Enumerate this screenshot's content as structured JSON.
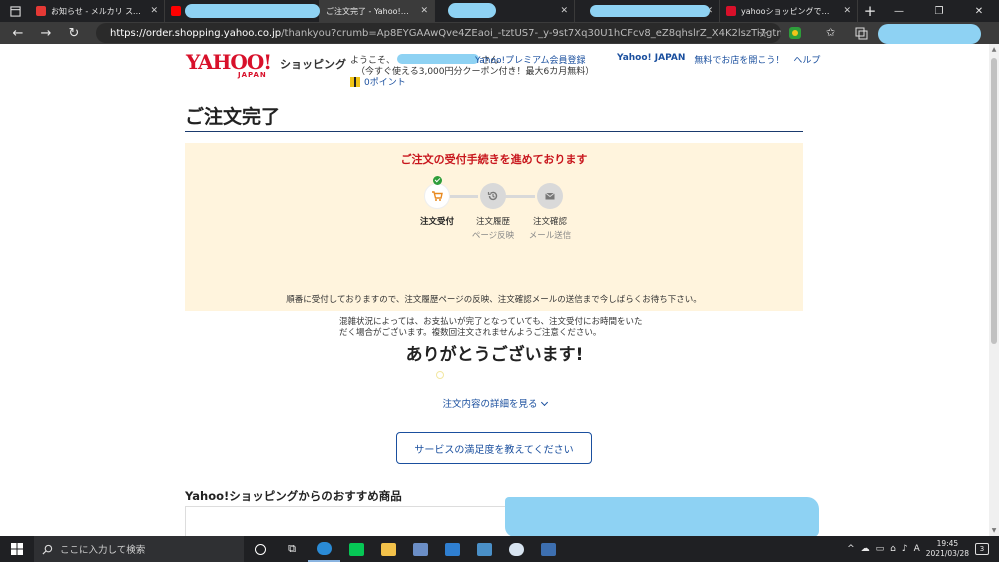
{
  "browser": {
    "tabs": [
      {
        "title": "お知らせ - メルカリ スマホでかんたん",
        "favicon_color": "#e53935",
        "active": false
      },
      {
        "title": "",
        "favicon_color": "#ff0000",
        "active": false
      },
      {
        "title": "ご注文完了 - Yahoo!ショッピング",
        "favicon_color": "#3b3b3b",
        "active": true
      },
      {
        "title": "",
        "favicon_color": "#8ed2f3",
        "active": false
      },
      {
        "title": "yahooショッピングで買い物をした",
        "favicon_color": "#d8102a",
        "active": false
      }
    ],
    "url_host": "https://order.shopping.yahoo.co.jp",
    "url_path": "/thankyou?crumb=Ap8EYGAAwQve4ZEaoi_-tztUS7-_y-9st7Xq30U1hCFcv8_eZ8qhslrZ_X4K2lszTi7gtm...",
    "window_controls": [
      "—",
      "❐",
      "✕"
    ]
  },
  "header": {
    "logo_text": "YAHOO!",
    "logo_sub": "JAPAN",
    "shopping_label": "ショッピング",
    "welcome_prefix": "ようこそ、",
    "welcome_suffix": "さん",
    "premium_link": "Yahoo!プレミアム会員登録",
    "coupon_text": "（今すぐ使える3,000円分クーポン付き！最大6カ月無料）",
    "points_text": "0ポイント",
    "links": {
      "yahoo_japan": "Yahoo! JAPAN",
      "open_store": "無料でお店を開こう！",
      "help": "ヘルプ"
    }
  },
  "main": {
    "page_title": "ご注文完了",
    "notice": {
      "heading": "ご注文の受付手続きを進めております",
      "steps": [
        {
          "label": "注文受付",
          "sub": "",
          "done": true,
          "icon": "cart-icon"
        },
        {
          "label": "注文履歴",
          "sub": "ページ反映",
          "done": false,
          "icon": "history-icon"
        },
        {
          "label": "注文確認",
          "sub": "メール送信",
          "done": false,
          "icon": "mail-icon"
        }
      ],
      "message": "順番に受付しておりますので、注文履歴ページの反映、注文確認メールの送信まで今しばらくお待ち下さい。",
      "caution": "混雑状況によっては、お支払いが完了となっていても、注文受付にお時間をいただく場合がございます。複数回注文されませんようご注意ください。"
    },
    "thanks": "ありがとうございます!",
    "detail_link": "注文内容の詳細を見る",
    "survey_button": "サービスの満足度を教えてください",
    "recommend_title": "Yahoo!ショッピングからのおすすめ商品"
  },
  "taskbar": {
    "search_placeholder": "ここに入力して検索",
    "time": "19:45",
    "date": "2021/03/28",
    "notification_count": "3"
  },
  "colors": {
    "yahoo_red": "#d8102a",
    "link_blue": "#1a4f9e",
    "notice_bg": "#fff4dd",
    "notice_heading": "#c8161d",
    "redaction": "#8ed2f3"
  }
}
